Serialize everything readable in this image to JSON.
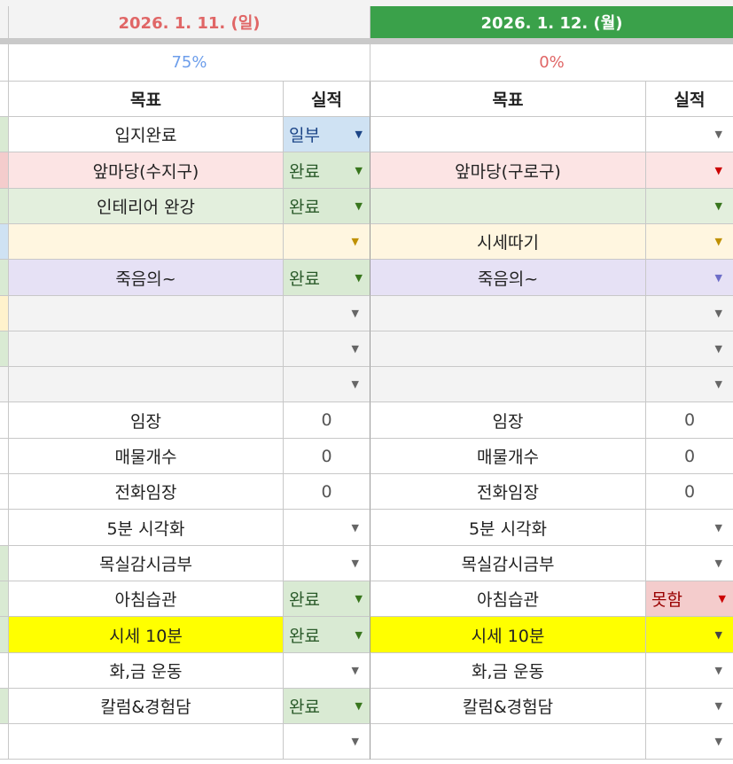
{
  "days": [
    {
      "date": "2026. 1. 11. (일)",
      "percent": "75%"
    },
    {
      "date": "2026. 1. 12. (월)",
      "percent": "0%"
    }
  ],
  "headers": {
    "goal": "목표",
    "result": "실적"
  },
  "status_colors": {
    "완료": {
      "bg": "#d9ead3",
      "fg": "#2a5a2a",
      "arrow": "#38761d"
    },
    "일부": {
      "bg": "#cfe2f3",
      "fg": "#1c4587",
      "arrow": "#1c4587"
    },
    "못함": {
      "bg": "#f4cccc",
      "fg": "#990000",
      "arrow": "#cc0000"
    }
  },
  "rows": [
    {
      "stub": "#d9ead3",
      "d1": {
        "goal": "입지완료",
        "bg": "#ffffff",
        "result": "일부",
        "type": "chip",
        "rbg": "#cfe2f3"
      },
      "d2": {
        "goal": "",
        "bg": "#ffffff",
        "result": "",
        "type": "dd",
        "rbg": "#ffffff",
        "arrow": "#666666"
      }
    },
    {
      "stub": "#f4cccc",
      "d1": {
        "goal": "앞마당(수지구)",
        "bg": "#fce4e4",
        "result": "완료",
        "type": "chip",
        "rbg": "#d9ead3"
      },
      "d2": {
        "goal": "앞마당(구로구)",
        "bg": "#fce4e4",
        "result": "",
        "type": "dd",
        "rbg": "#fce4e4",
        "arrow": "#cc0000"
      }
    },
    {
      "stub": "#d9ead3",
      "d1": {
        "goal": "인테리어 완강",
        "bg": "#e3efdd",
        "result": "완료",
        "type": "chip",
        "rbg": "#d9ead3"
      },
      "d2": {
        "goal": "",
        "bg": "#e3efdd",
        "result": "",
        "type": "dd",
        "rbg": "#e3efdd",
        "arrow": "#38761d"
      }
    },
    {
      "stub": "#cfe2f3",
      "d1": {
        "goal": "",
        "bg": "#fff6e0",
        "result": "",
        "type": "dd",
        "rbg": "#fff6e0",
        "arrow": "#bf9000"
      },
      "d2": {
        "goal": "시세따기",
        "bg": "#fff6e0",
        "result": "",
        "type": "dd",
        "rbg": "#fff6e0",
        "arrow": "#bf9000"
      }
    },
    {
      "stub": "#d9ead3",
      "d1": {
        "goal": "죽음의~",
        "bg": "#e6e1f5",
        "result": "완료",
        "type": "chip",
        "rbg": "#d9ead3"
      },
      "d2": {
        "goal": "죽음의~",
        "bg": "#e6e1f5",
        "result": "",
        "type": "dd",
        "rbg": "#e6e1f5",
        "arrow": "#6d6dc8"
      }
    },
    {
      "stub": "#fff2cc",
      "d1": {
        "goal": "",
        "bg": "#f3f3f3",
        "result": "",
        "type": "dd",
        "rbg": "#f3f3f3",
        "arrow": "#666666"
      },
      "d2": {
        "goal": "",
        "bg": "#f3f3f3",
        "result": "",
        "type": "dd",
        "rbg": "#f3f3f3",
        "arrow": "#666666"
      }
    },
    {
      "stub": "#d9ead3",
      "d1": {
        "goal": "",
        "bg": "#f3f3f3",
        "result": "",
        "type": "dd",
        "rbg": "#f3f3f3",
        "arrow": "#666666"
      },
      "d2": {
        "goal": "",
        "bg": "#f3f3f3",
        "result": "",
        "type": "dd",
        "rbg": "#f3f3f3",
        "arrow": "#666666"
      }
    },
    {
      "stub": "#f3f3f3",
      "d1": {
        "goal": "",
        "bg": "#f3f3f3",
        "result": "",
        "type": "dd",
        "rbg": "#f3f3f3",
        "arrow": "#666666"
      },
      "d2": {
        "goal": "",
        "bg": "#f3f3f3",
        "result": "",
        "type": "dd",
        "rbg": "#f3f3f3",
        "arrow": "#666666"
      }
    },
    {
      "stub": "#ffffff",
      "d1": {
        "goal": "임장",
        "bg": "#ffffff",
        "result": "0",
        "type": "num",
        "rbg": "#ffffff"
      },
      "d2": {
        "goal": "임장",
        "bg": "#ffffff",
        "result": "0",
        "type": "num",
        "rbg": "#ffffff"
      }
    },
    {
      "stub": "#ffffff",
      "d1": {
        "goal": "매물개수",
        "bg": "#ffffff",
        "result": "0",
        "type": "num",
        "rbg": "#ffffff"
      },
      "d2": {
        "goal": "매물개수",
        "bg": "#ffffff",
        "result": "0",
        "type": "num",
        "rbg": "#ffffff"
      }
    },
    {
      "stub": "#ffffff",
      "d1": {
        "goal": "전화임장",
        "bg": "#ffffff",
        "result": "0",
        "type": "num",
        "rbg": "#ffffff"
      },
      "d2": {
        "goal": "전화임장",
        "bg": "#ffffff",
        "result": "0",
        "type": "num",
        "rbg": "#ffffff"
      }
    },
    {
      "stub": "#ffffff",
      "d1": {
        "goal": "5분 시각화",
        "bg": "#ffffff",
        "result": "",
        "type": "dd",
        "rbg": "#ffffff",
        "arrow": "#666666"
      },
      "d2": {
        "goal": "5분 시각화",
        "bg": "#ffffff",
        "result": "",
        "type": "dd",
        "rbg": "#ffffff",
        "arrow": "#666666"
      }
    },
    {
      "stub": "#d9ead3",
      "d1": {
        "goal": "목실감시금부",
        "bg": "#ffffff",
        "result": "",
        "type": "dd",
        "rbg": "#ffffff",
        "arrow": "#666666"
      },
      "d2": {
        "goal": "목실감시금부",
        "bg": "#ffffff",
        "result": "",
        "type": "dd",
        "rbg": "#ffffff",
        "arrow": "#666666"
      }
    },
    {
      "stub": "#d9ead3",
      "d1": {
        "goal": "아침습관",
        "bg": "#ffffff",
        "result": "완료",
        "type": "chip",
        "rbg": "#d9ead3"
      },
      "d2": {
        "goal": "아침습관",
        "bg": "#ffffff",
        "result": "못함",
        "type": "chip",
        "rbg": "#f4cccc"
      }
    },
    {
      "stub": "#d9ead3",
      "d1": {
        "goal": "시세 10분",
        "bg": "#ffff00",
        "result": "완료",
        "type": "chip",
        "rbg": "#d9ead3"
      },
      "d2": {
        "goal": "시세 10분",
        "bg": "#ffff00",
        "result": "",
        "type": "dd",
        "rbg": "#ffff00",
        "arrow": "#444444"
      }
    },
    {
      "stub": "#ffffff",
      "d1": {
        "goal": "화,금 운동",
        "bg": "#ffffff",
        "result": "",
        "type": "dd",
        "rbg": "#ffffff",
        "arrow": "#666666"
      },
      "d2": {
        "goal": "화,금 운동",
        "bg": "#ffffff",
        "result": "",
        "type": "dd",
        "rbg": "#ffffff",
        "arrow": "#666666"
      }
    },
    {
      "stub": "#d9ead3",
      "d1": {
        "goal": "칼럼&경험담",
        "bg": "#ffffff",
        "result": "완료",
        "type": "chip",
        "rbg": "#d9ead3"
      },
      "d2": {
        "goal": "칼럼&경험담",
        "bg": "#ffffff",
        "result": "",
        "type": "dd",
        "rbg": "#ffffff",
        "arrow": "#666666"
      }
    },
    {
      "stub": "#ffffff",
      "d1": {
        "goal": "",
        "bg": "#ffffff",
        "result": "",
        "type": "dd",
        "rbg": "#ffffff",
        "arrow": "#666666"
      },
      "d2": {
        "goal": "",
        "bg": "#ffffff",
        "result": "",
        "type": "dd",
        "rbg": "#ffffff",
        "arrow": "#666666"
      }
    }
  ]
}
